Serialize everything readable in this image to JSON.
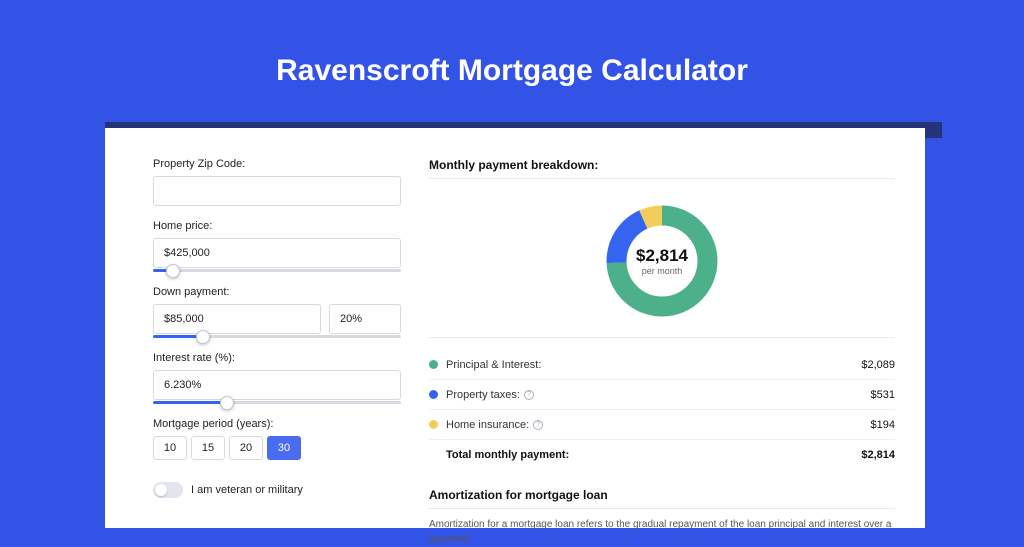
{
  "page": {
    "title": "Ravenscroft Mortgage Calculator"
  },
  "form": {
    "zip": {
      "label": "Property Zip Code:",
      "value": ""
    },
    "home_price": {
      "label": "Home price:",
      "value": "$425,000",
      "slider_pct": 8
    },
    "down_payment": {
      "label": "Down payment:",
      "amount": "$85,000",
      "pct": "20%",
      "slider_pct": 20
    },
    "interest": {
      "label": "Interest rate (%):",
      "value": "6.230%",
      "slider_pct": 30
    },
    "period": {
      "label": "Mortgage period (years):",
      "options": [
        "10",
        "15",
        "20",
        "30"
      ],
      "selected": "30"
    },
    "veteran": {
      "label": "I am veteran or military",
      "on": false
    }
  },
  "breakdown": {
    "title": "Monthly payment breakdown:",
    "total_amount": "$2,814",
    "total_sub": "per month",
    "items": [
      {
        "label": "Principal & Interest:",
        "value": "$2,089",
        "has_info": false
      },
      {
        "label": "Property taxes:",
        "value": "$531",
        "has_info": true
      },
      {
        "label": "Home insurance:",
        "value": "$194",
        "has_info": true
      }
    ],
    "total_row": {
      "label": "Total monthly payment:",
      "value": "$2,814"
    }
  },
  "chart_data": {
    "type": "pie",
    "title": "Monthly payment breakdown",
    "series": [
      {
        "name": "Principal & Interest",
        "value": 2089,
        "color": "#4cb08a"
      },
      {
        "name": "Property taxes",
        "value": 531,
        "color": "#3565f0"
      },
      {
        "name": "Home insurance",
        "value": 194,
        "color": "#f2cd5c"
      }
    ],
    "total": 2814,
    "center_label": "$2,814",
    "center_sublabel": "per month"
  },
  "amortization": {
    "title": "Amortization for mortgage loan",
    "text": "Amortization for a mortgage loan refers to the gradual repayment of the loan principal and interest over a specified"
  }
}
